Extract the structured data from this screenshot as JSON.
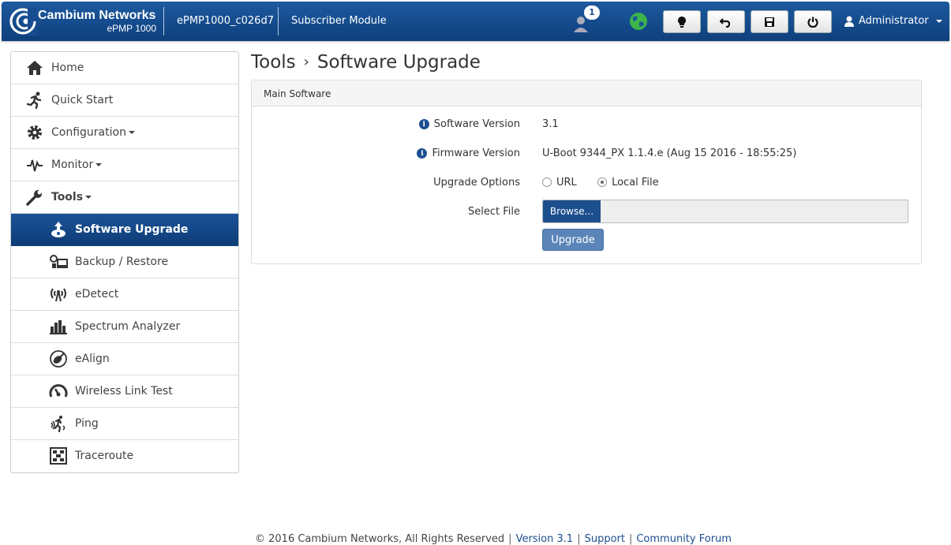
{
  "header": {
    "brand_name": "Cambium Networks",
    "brand_model": "ePMP 1000",
    "device_name": "ePMP1000_c026d7",
    "mode": "Subscriber Module",
    "user_count": "1",
    "user_label": "Administrator"
  },
  "sidebar": {
    "items": [
      {
        "label": "Home",
        "icon": "home-icon"
      },
      {
        "label": "Quick Start",
        "icon": "runner-icon"
      },
      {
        "label": "Configuration",
        "icon": "gear-icon"
      },
      {
        "label": "Monitor",
        "icon": "pulse-icon"
      },
      {
        "label": "Tools",
        "icon": "wrench-icon"
      },
      {
        "label": "Software Upgrade",
        "icon": "software-upgrade-icon"
      },
      {
        "label": "Backup / Restore",
        "icon": "backup-icon"
      },
      {
        "label": "eDetect",
        "icon": "edetect-icon"
      },
      {
        "label": "Spectrum Analyzer",
        "icon": "bar-chart-icon"
      },
      {
        "label": "eAlign",
        "icon": "dish-icon"
      },
      {
        "label": "Wireless Link Test",
        "icon": "gauge-icon"
      },
      {
        "label": "Ping",
        "icon": "ping-icon"
      },
      {
        "label": "Traceroute",
        "icon": "traceroute-icon"
      }
    ]
  },
  "main": {
    "breadcrumb_parent": "Tools",
    "breadcrumb_current": "Software Upgrade",
    "panel_title": "Main Software",
    "software_version_label": "Software Version",
    "software_version_value": "3.1",
    "firmware_version_label": "Firmware Version",
    "firmware_version_value": "U-Boot 9344_PX 1.1.4.e (Aug 15 2016 - 18:55:25)",
    "upgrade_options_label": "Upgrade Options",
    "option_url": "URL",
    "option_local": "Local File",
    "selected_option": "Local File",
    "select_file_label": "Select File",
    "browse_label": "Browse...",
    "upgrade_label": "Upgrade"
  },
  "footer": {
    "copyright": "© 2016 Cambium Networks, All Rights Reserved",
    "version": "Version 3.1",
    "support": "Support",
    "community": "Community Forum"
  },
  "colors": {
    "brand_blue": "#0e3f7c",
    "globe_green": "#3cb44a"
  }
}
